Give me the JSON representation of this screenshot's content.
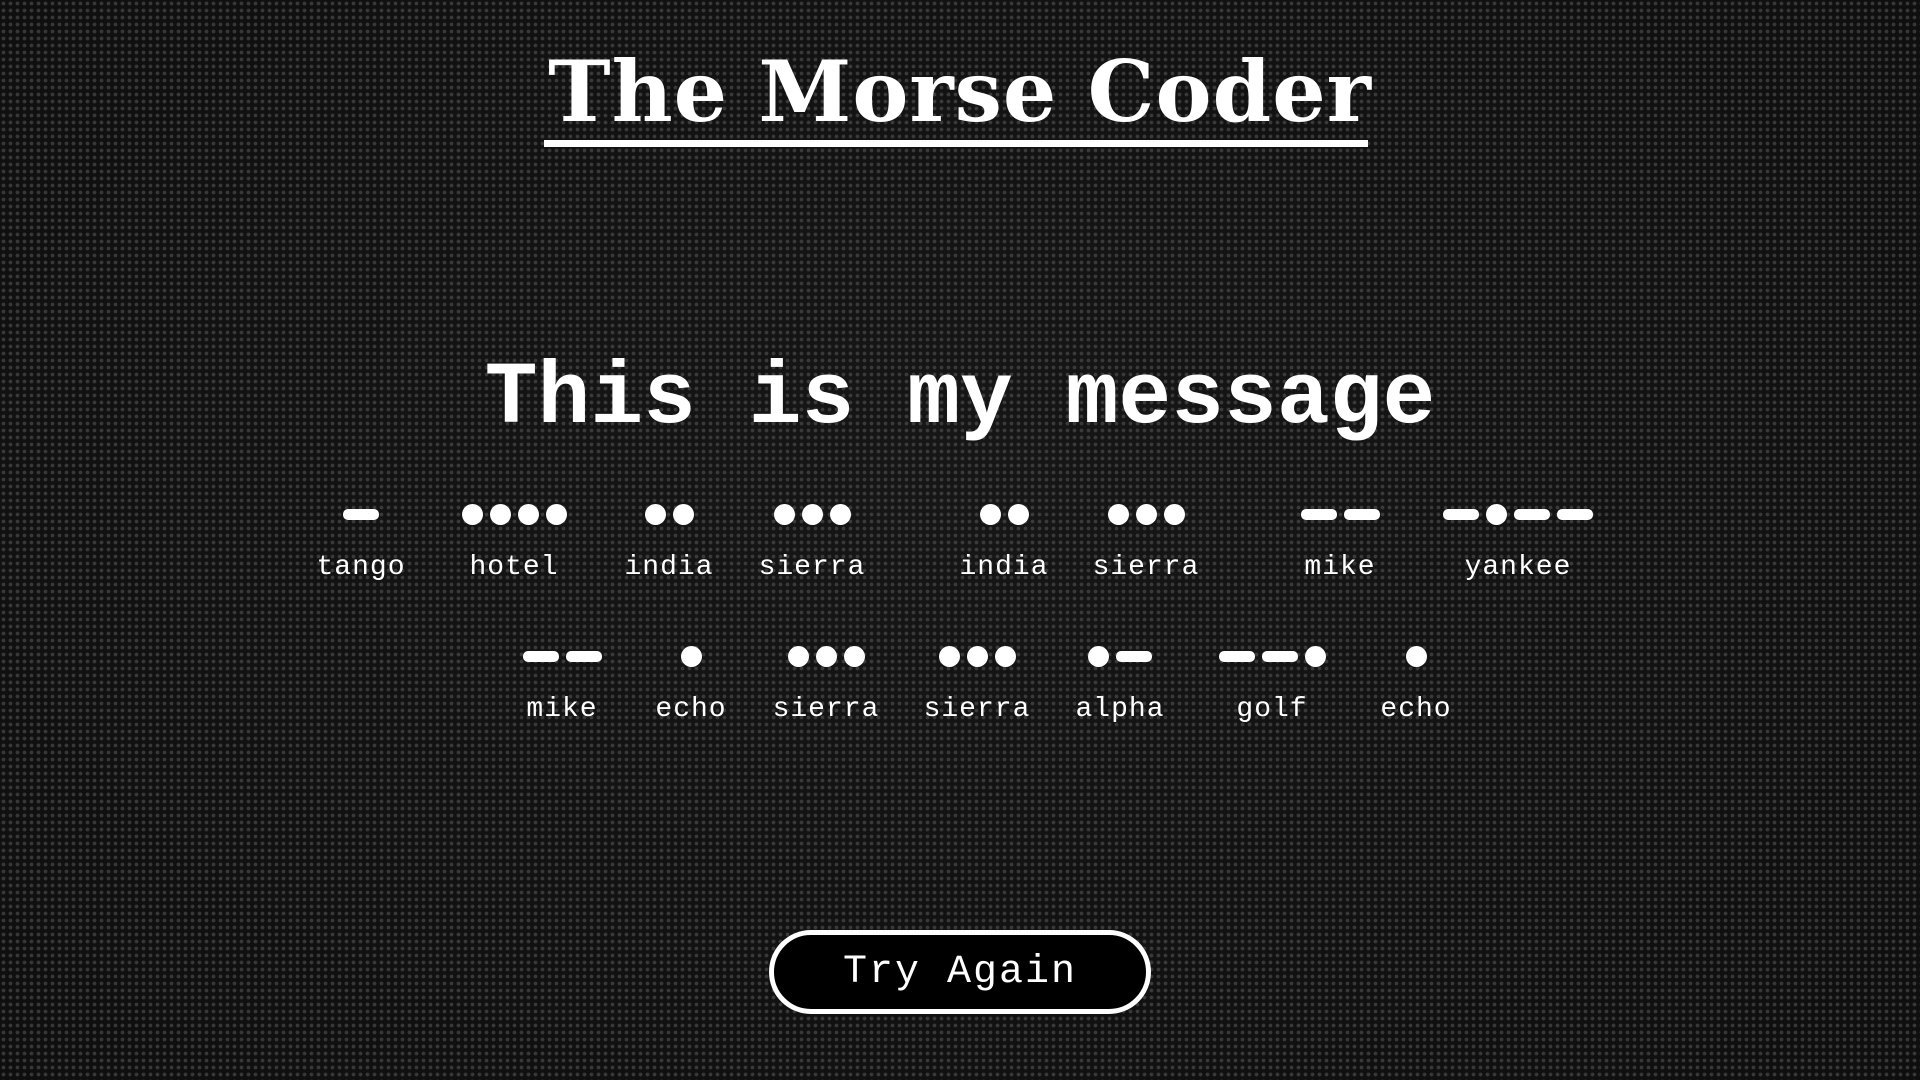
{
  "app": {
    "title": "The Morse Coder"
  },
  "message": {
    "text": "This is my message"
  },
  "words": [
    {
      "letters": [
        {
          "code": "-",
          "name": "tango"
        },
        {
          "code": "....",
          "name": "hotel"
        },
        {
          "code": "..",
          "name": "india"
        },
        {
          "code": "...",
          "name": "sierra"
        }
      ]
    },
    {
      "letters": [
        {
          "code": "..",
          "name": "india"
        },
        {
          "code": "...",
          "name": "sierra"
        }
      ]
    },
    {
      "letters": [
        {
          "code": "--",
          "name": "mike"
        },
        {
          "code": "-.--",
          "name": "yankee"
        }
      ]
    },
    {
      "letters": [
        {
          "code": "--",
          "name": "mike"
        },
        {
          "code": ".",
          "name": "echo"
        },
        {
          "code": "...",
          "name": "sierra"
        },
        {
          "code": "...",
          "name": "sierra"
        },
        {
          "code": ".-",
          "name": "alpha"
        },
        {
          "code": "--.",
          "name": "golf"
        },
        {
          "code": ".",
          "name": "echo"
        }
      ]
    }
  ],
  "actions": {
    "try_again_label": "Try Again"
  }
}
